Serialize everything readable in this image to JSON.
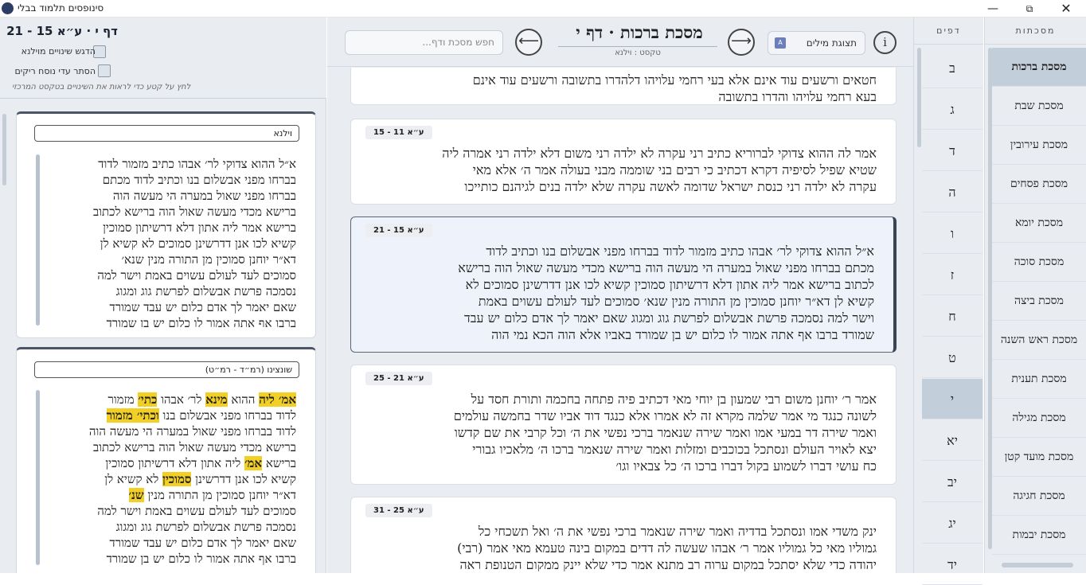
{
  "app": {
    "title": "סינופסים תלמוד בבלי",
    "minimize": "—",
    "maximize": "⧉",
    "close": "✕"
  },
  "left_panel": {
    "header_title": "דף י · ע״א 15 - 21",
    "checkbox1_label": "הדגש שינויים מוילנא",
    "checkbox2_label": "הסתר עדי נוסח ריקים",
    "hint": "לחץ על קטע כדי לראות את השינויים בטקסט המרכזי",
    "versions": [
      {
        "label": "וילנא",
        "lines": [
          "א״ל ההוא צדוקי לר׳ אבהו כתיב מזמור לדוד",
          "בברחו מפני אבשלום בנו וכתיב לדוד מכתם",
          "בברחו מפני שאול במערה הי מעשה הוה",
          "ברישא מכדי מעשה שאול הוה ברישא לכתוב",
          "ברישא אמר ליה אתון דלא דרשיתון סמוכין",
          "קשיא לכו אנן דדרשינן סמוכים לא קשיא לן",
          "דא״ר יוחנן סמוכין מן התורה מנין שנא׳",
          "סמוכים לעד לעולם עשוים באמת וישר למה",
          "נסמכה פרשת אבשלום לפרשת גוג ומגוג",
          "שאם יאמר לך אדם כלום יש עבד שמורד",
          "ברבו אף אתה אמור לו כלום יש בן שמורד"
        ]
      },
      {
        "label": "שונצינו (רמ״ד - רמ״ט)",
        "lines": [
          [
            {
              "t": "אמ׳ ליה",
              "h": true
            },
            {
              "t": " ההוא ",
              "h": false
            },
            {
              "t": "מינא",
              "h": true
            },
            {
              "t": " לר׳ אבהו ",
              "h": false
            },
            {
              "t": "כתי׳",
              "h": true
            },
            {
              "t": " מזמור",
              "h": false
            }
          ],
          [
            {
              "t": "לדוד בברחו מפני אבשלום בנו ",
              "h": false
            },
            {
              "t": "וכתי׳ מזמור",
              "h": true
            }
          ],
          [
            {
              "t": "לדוד בברחו מפני שאול במערה הי מעשה הוה",
              "h": false
            }
          ],
          [
            {
              "t": "ברישא מכדי מעשה שאול הוה ברישא לכתוב",
              "h": false
            }
          ],
          [
            {
              "t": "ברישא ",
              "h": false
            },
            {
              "t": "אמ׳",
              "h": true
            },
            {
              "t": " ליה אתון דלא דרשיתון סמוכין",
              "h": false
            }
          ],
          [
            {
              "t": "קשיא לכו אנן דדרשינן ",
              "h": false
            },
            {
              "t": "סמוכין",
              "h": true
            },
            {
              "t": " לא קשיא לן",
              "h": false
            }
          ],
          [
            {
              "t": "דא״ר יוחנן סמוכין מן התורה מנין ",
              "h": false
            },
            {
              "t": "שנ׳",
              "h": true
            }
          ],
          [
            {
              "t": "סמוכים לעד לעולם עשוים באמת וישר למה",
              "h": false
            }
          ],
          [
            {
              "t": "נסמכה פרשת אבשלום לפרשת גוג ומגוג",
              "h": false
            }
          ],
          [
            {
              "t": "שאם יאמר לך אדם כלום יש עבד שמורד",
              "h": false
            }
          ],
          [
            {
              "t": "ברבו אף אתה אמור לו כלום יש בן שמורד",
              "h": false
            }
          ]
        ]
      }
    ]
  },
  "center": {
    "search_placeholder": "חפש מסכת ודף...",
    "prev_arrow": "⟵",
    "next_arrow": "⟶",
    "title": "מסכת ברכות · דף י",
    "subtitle": "טקסט : וילנא",
    "word_view_label": "תצוגת מילים",
    "info_label": "i",
    "segments": [
      {
        "badge": "",
        "lines": [
          "חטאים ורשעים עוד אינם אלא בעי רחמי עלויהו דלהדרו בתשובה ורשעים עוד אינם",
          "בעא רחמי עלויהו והדרו בתשובה"
        ]
      },
      {
        "badge": "ע״א 11 - 15",
        "lines": [
          "אמר לה ההוא צדוקי לברוריא כתיב רני עקרה לא ילדה רני משום דלא ילדה רני אמרה ליה",
          "שטיא שפיל לסיפיה דקרא דכתיב כי רבים בני שוממה מבני בעולה אמר ה׳ אלא מאי",
          "עקרה לא ילדה רני כנסת ישראל שדומה לאשה עקרה שלא ילדה בנים לגיהנם כותייכו"
        ]
      },
      {
        "badge": "ע״א 15 - 21",
        "lines": [
          "א״ל ההוא צדוקי לר׳ אבהו כתיב מזמור לדוד בברחו מפני אבשלום בנו וכתיב לדוד",
          "מכתם בברחו מפני שאול במערה הי מעשה הוה ברישא מכדי מעשה שאול הוה ברישא",
          "לכתוב ברישא אמר ליה אתון דלא דרשיתון סמוכין קשיא לכו אנן דדרשינן סמוכים לא",
          "קשיא לן דא״ר יוחנן סמוכין מן התורה מנין שנא׳ סמוכים לעד לעולם עשוים באמת",
          "וישר למה נסמכה פרשת אבשלום לפרשת גוג ומגוג שאם יאמר לך אדם כלום יש עבד",
          "שמורד ברבו אף אתה אמור לו כלום יש בן שמורד באביו אלא הוה הכא נמי הוה"
        ]
      },
      {
        "badge": "ע״א 21 - 25",
        "lines": [
          "אמר ר׳ יוחנן משום רבי שמעון בן יוחי מאי דכתיב פיה פתחה בחכמה ותורת חסד על",
          "לשונה כנגד מי אמר שלמה מקרא זה לא אמרו אלא כנגד דוד אביו שדר בחמשה עולמים",
          "ואמר שירה דר במעי אמו ואמר שירה שנאמר ברכי נפשי את ה׳ וכל קרבי את שם קדשו",
          "יצא לאויר העולם ונסתכל בכוכבים ומזלות ואמר שירה שנאמר ברכו ה׳ מלאכיו גבורי",
          "כח עושי דברו לשמוע בקול דברו ברכו ה׳ כל צבאיו וגו׳"
        ]
      },
      {
        "badge": "ע״א 25 - 31",
        "lines": [
          "ינק משדי אמו ונסתכל בדדיה ואמר שירה שנאמר ברכי נפשי את ה׳ ואל תשכחי כל",
          "גמוליו מאי כל גמוליו אמר ר׳ אבהו שעשה לה דדים במקום בינה טעמא מאי אמר (רבי)",
          "יהודה כדי שלא יסתכל במקום ערוה רב מתנא אמר כדי שלא יינק ממקום הטנופת ראה"
        ]
      }
    ]
  },
  "pages": {
    "header": "דפים",
    "items": [
      "ב",
      "ג",
      "ד",
      "ה",
      "ו",
      "ז",
      "ח",
      "ט",
      "י",
      "יא",
      "יב",
      "יג",
      "יד"
    ],
    "selected": "י"
  },
  "tractates": {
    "header": "מסכתות",
    "items": [
      "מסכת ברכות",
      "מסכת שבת",
      "מסכת עירובין",
      "מסכת פסחים",
      "מסכת יומא",
      "מסכת סוכה",
      "מסכת ביצה",
      "מסכת ראש השנה",
      "מסכת תענית",
      "מסכת מגילה",
      "מסכת מועד קטן",
      "מסכת חגיגה",
      "מסכת יבמות"
    ],
    "selected": "מסכת ברכות"
  }
}
